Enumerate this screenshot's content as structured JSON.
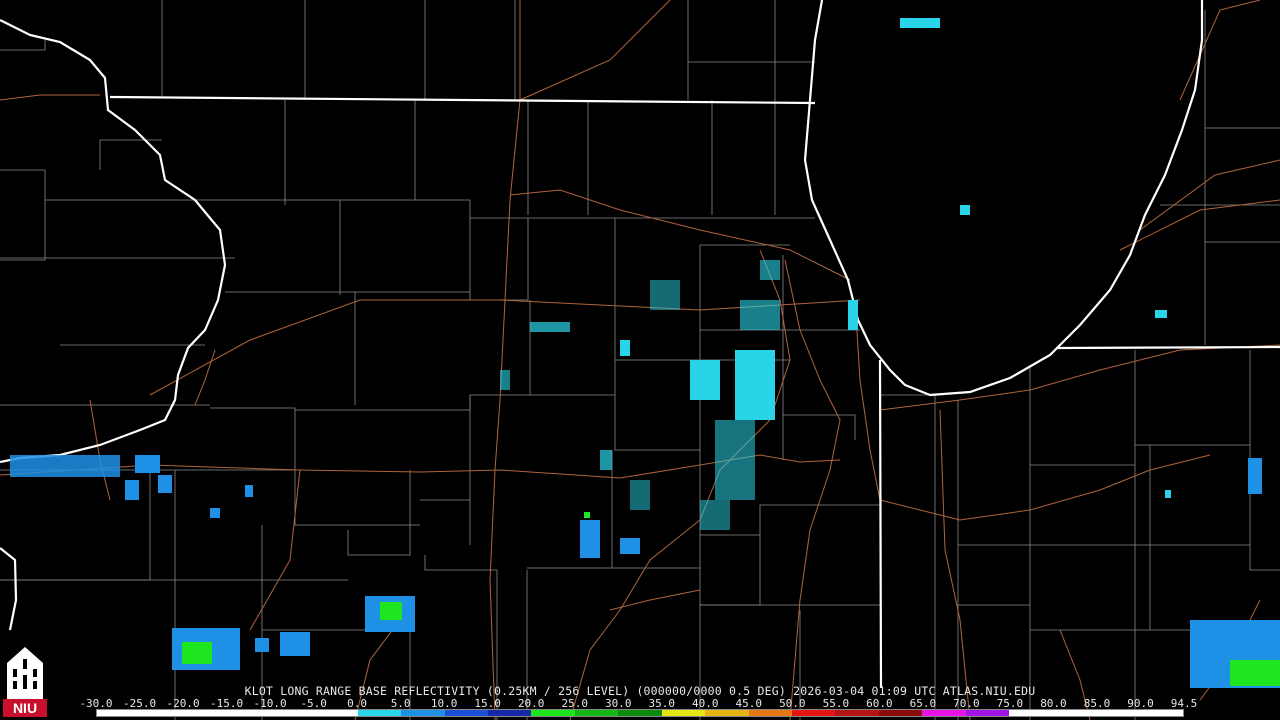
{
  "caption": "KLOT LONG RANGE BASE REFLECTIVITY (0.25KM / 256 LEVEL) (000000/0000 0.5 DEG) 2026-03-04 01:09 UTC  ATLAS.NIU.EDU",
  "logo": {
    "text": "NIU",
    "icon": "niu-castle-icon",
    "color": "#c8102e"
  },
  "legend": {
    "ticks": [
      "-30.0",
      "-25.0",
      "-20.0",
      "-15.0",
      "-10.0",
      "-5.0",
      "0.0",
      "5.0",
      "10.0",
      "15.0",
      "20.0",
      "25.0",
      "30.0",
      "35.0",
      "40.0",
      "45.0",
      "50.0",
      "55.0",
      "60.0",
      "65.0",
      "70.0",
      "75.0",
      "80.0",
      "85.0",
      "90.0",
      "94.5"
    ],
    "colors": [
      "#ffffff",
      "#ffffff",
      "#ffffff",
      "#ffffff",
      "#ffffff",
      "#ffffff",
      "#2ad4e8",
      "#1e90e6",
      "#1c4fd8",
      "#1428a8",
      "#1ee61e",
      "#14b814",
      "#0a8a0a",
      "#e6e614",
      "#e6b414",
      "#e67814",
      "#e61414",
      "#b41414",
      "#8c0a0a",
      "#e614e6",
      "#a014e6",
      "#ffffff",
      "#ffffff",
      "#ffffff",
      "#ffffff"
    ]
  },
  "map_colors": {
    "background": "#000000",
    "state_border": "#ffffff",
    "county_border": "#8a8a8a",
    "road": "#b0643c"
  }
}
